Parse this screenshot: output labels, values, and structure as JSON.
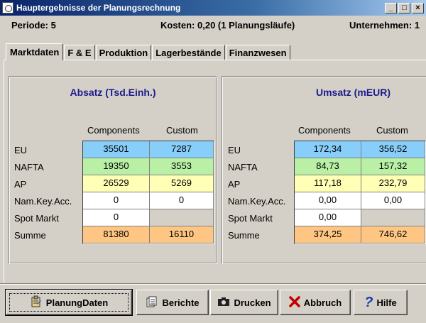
{
  "window": {
    "title": "Hauptergebnisse der Planungsrechnung"
  },
  "info": {
    "periode": "Periode: 5",
    "kosten": "Kosten: 0,20 (1 Planungsläufe)",
    "unternehmen": "Unternehmen: 1"
  },
  "tabs": [
    {
      "label": "Marktdaten",
      "active": true
    },
    {
      "label": "F & E"
    },
    {
      "label": "Produktion"
    },
    {
      "label": "Lagerbestände"
    },
    {
      "label": "Finanzwesen"
    }
  ],
  "absatz": {
    "title": "Absatz (Tsd.Einh.)",
    "columns": [
      "Components",
      "Custom"
    ],
    "rows": [
      {
        "label": "EU",
        "values": [
          "35501",
          "7287"
        ]
      },
      {
        "label": "NAFTA",
        "values": [
          "19350",
          "3553"
        ]
      },
      {
        "label": "AP",
        "values": [
          "26529",
          "5269"
        ]
      },
      {
        "label": "Nam.Key.Acc.",
        "values": [
          "0",
          "0"
        ]
      },
      {
        "label": "Spot Markt",
        "values": [
          "0",
          ""
        ]
      },
      {
        "label": "Summe",
        "values": [
          "81380",
          "16110"
        ]
      }
    ]
  },
  "umsatz": {
    "title": "Umsatz (mEUR)",
    "columns": [
      "Components",
      "Custom"
    ],
    "rows": [
      {
        "label": "EU",
        "values": [
          "172,34",
          "356,52"
        ]
      },
      {
        "label": "NAFTA",
        "values": [
          "84,73",
          "157,32"
        ]
      },
      {
        "label": "AP",
        "values": [
          "117,18",
          "232,79"
        ]
      },
      {
        "label": "Nam.Key.Acc.",
        "values": [
          "0,00",
          "0,00"
        ]
      },
      {
        "label": "Spot Markt",
        "values": [
          "0,00",
          ""
        ]
      },
      {
        "label": "Summe",
        "values": [
          "374,25",
          "746,62"
        ]
      }
    ]
  },
  "row_colors": [
    "#87cefa",
    "#b9f0a6",
    "#ffffb5",
    "#ffffff",
    "#ffffff",
    "#ffc683"
  ],
  "buttons": {
    "planungdaten": "PlanungDaten",
    "berichte": "Berichte",
    "drucken": "Drucken",
    "abbruch": "Abbruch",
    "hilfe": "Hilfe"
  }
}
